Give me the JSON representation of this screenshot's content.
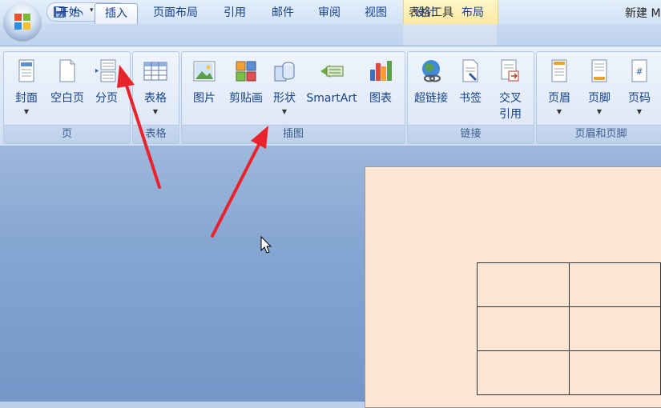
{
  "titlebar": {
    "contextual_group": "表格工具",
    "document_title": "新建 M"
  },
  "tabs": [
    {
      "label": "开始",
      "active": false
    },
    {
      "label": "插入",
      "active": true
    },
    {
      "label": "页面布局",
      "active": false
    },
    {
      "label": "引用",
      "active": false
    },
    {
      "label": "邮件",
      "active": false
    },
    {
      "label": "审阅",
      "active": false
    },
    {
      "label": "视图",
      "active": false
    },
    {
      "label": "设计",
      "active": false
    },
    {
      "label": "布局",
      "active": false
    }
  ],
  "ribbon": {
    "groups": [
      {
        "label": "页",
        "buttons": [
          {
            "label": "封面",
            "icon": "cover-page-icon"
          },
          {
            "label": "空白页",
            "icon": "blank-page-icon"
          },
          {
            "label": "分页",
            "icon": "page-break-icon"
          }
        ]
      },
      {
        "label": "表格",
        "buttons": [
          {
            "label": "表格",
            "icon": "table-icon"
          }
        ]
      },
      {
        "label": "插图",
        "buttons": [
          {
            "label": "图片",
            "icon": "picture-icon"
          },
          {
            "label": "剪贴画",
            "icon": "clip-art-icon"
          },
          {
            "label": "形状",
            "icon": "shapes-icon"
          },
          {
            "label": "SmartArt",
            "icon": "smartart-icon"
          },
          {
            "label": "图表",
            "icon": "chart-icon"
          }
        ]
      },
      {
        "label": "链接",
        "buttons": [
          {
            "label": "超链接",
            "icon": "hyperlink-icon"
          },
          {
            "label": "书签",
            "icon": "bookmark-icon"
          },
          {
            "label": "交叉",
            "label2": "引用",
            "icon": "cross-reference-icon"
          }
        ]
      },
      {
        "label": "页眉和页脚",
        "buttons": [
          {
            "label": "页眉",
            "icon": "header-icon"
          },
          {
            "label": "页脚",
            "icon": "footer-icon"
          },
          {
            "label": "页码",
            "icon": "page-number-icon"
          }
        ]
      }
    ]
  },
  "colors": {
    "arrow": "#e8232b",
    "page": "#fce6d6",
    "accent": "#15428b"
  }
}
